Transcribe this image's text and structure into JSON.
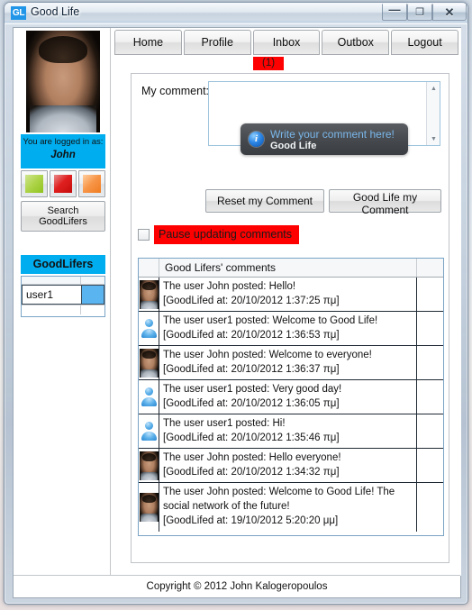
{
  "window": {
    "logo_text": "GL",
    "title": "Good Life",
    "minimize_glyph": "—",
    "maximize_glyph": "❐",
    "close_glyph": "✕"
  },
  "sidebar": {
    "avatar_name": "user-avatar-photo",
    "logged_in_label": "You are logged in as:",
    "logged_in_user": "John",
    "color_buttons": [
      {
        "name": "green-color-button",
        "color": "#8fc31f"
      },
      {
        "name": "red-color-button",
        "color": "#e02020"
      },
      {
        "name": "orange-color-button",
        "color": "#ef7c20"
      }
    ],
    "search_button": "Search GoodLifers",
    "goodlifers_header": "GoodLifers",
    "goodlifers_rows": [
      {
        "user": "user1",
        "status_color": "#59b4f0"
      }
    ]
  },
  "tabs": [
    {
      "label": "Home",
      "name": "tab-home"
    },
    {
      "label": "Profile",
      "name": "tab-profile"
    },
    {
      "label": "Inbox",
      "name": "tab-inbox"
    },
    {
      "label": "Outbox",
      "name": "tab-outbox"
    },
    {
      "label": "Logout",
      "name": "tab-logout"
    }
  ],
  "inbox_badge": "(1)",
  "comment_form": {
    "label": "My comment:",
    "textarea_value": "",
    "tooltip_title": "Write your comment here!",
    "tooltip_body": "Good Life",
    "tooltip_icon_glyph": "i",
    "reset_button": "Reset my Comment",
    "submit_button": "Good Life my Comment",
    "pause_label": "Pause updating comments",
    "pause_checked": false,
    "pause_highlight_color": "#ff0000"
  },
  "comments": {
    "header": "Good Lifers' comments",
    "rows": [
      {
        "avatar": "john-photo",
        "line1": "The user John posted: Hello!",
        "line2": "[GoodLifed at: 20/10/2012 1:37:25 πμ]"
      },
      {
        "avatar": "generic-user",
        "line1": "The user user1 posted: Welcome to Good Life!",
        "line2": "[GoodLifed at: 20/10/2012 1:36:53 πμ]"
      },
      {
        "avatar": "john-photo",
        "line1": "The user John posted: Welcome to everyone!",
        "line2": "[GoodLifed at: 20/10/2012 1:36:37 πμ]"
      },
      {
        "avatar": "generic-user",
        "line1": "The user user1 posted: Very good day!",
        "line2": "[GoodLifed at: 20/10/2012 1:36:05 πμ]"
      },
      {
        "avatar": "generic-user",
        "line1": "The user user1 posted: Hi!",
        "line2": "[GoodLifed at: 20/10/2012 1:35:46 πμ]"
      },
      {
        "avatar": "john-photo",
        "line1": "The user John posted: Hello everyone!",
        "line2": "[GoodLifed at: 20/10/2012 1:34:32 πμ]"
      },
      {
        "avatar": "john-photo",
        "line1": "The user John posted: Welcome to Good Life! The social network of the future!",
        "line2": "[GoodLifed at: 19/10/2012 5:20:20 μμ]"
      }
    ]
  },
  "footer": {
    "copyright": "Copyright © 2012 John Kalogeropoulos"
  },
  "colors": {
    "accent_blue": "#00aeef",
    "alert_red": "#ff0000",
    "grid_border": "#7aa3c4"
  }
}
